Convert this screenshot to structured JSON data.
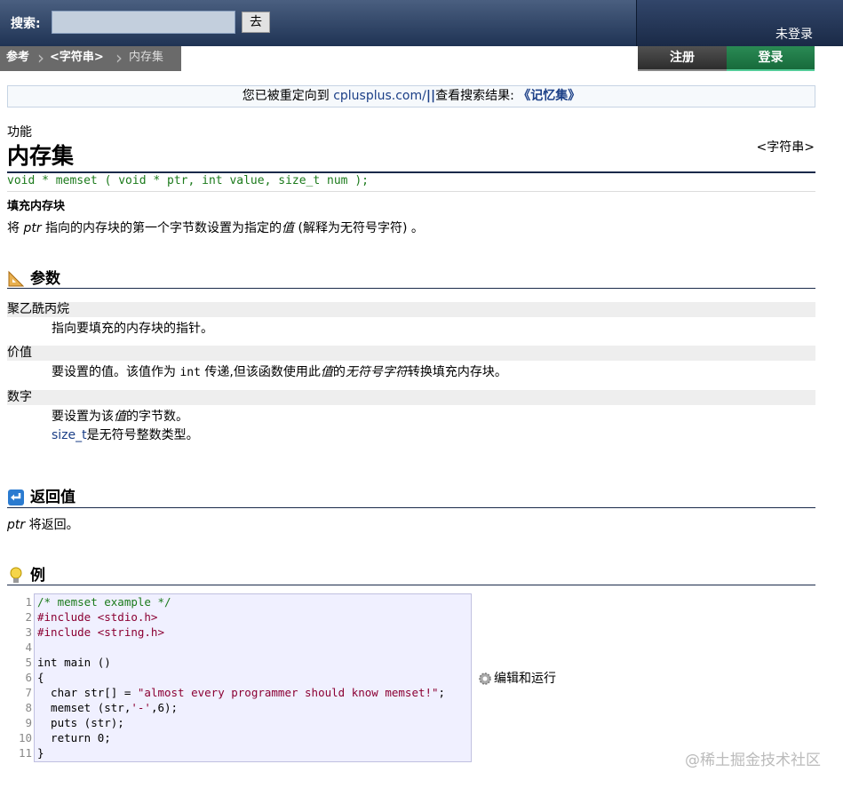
{
  "header": {
    "search_label": "搜索:",
    "search_value": "",
    "go_button": "去",
    "user_status": "未登录"
  },
  "breadcrumb": [
    "参考",
    "<字符串>",
    "内存集"
  ],
  "account": {
    "register": "注册",
    "login": "登录"
  },
  "redirect": {
    "prefix": "您已被重定向到",
    "site": "cplusplus.com/",
    "bars": "||",
    "middle": "查看搜索结果:",
    "result_link": "《记忆集》"
  },
  "reference": {
    "kind": "功能",
    "title": "内存集",
    "header_tag": "<字符串>",
    "prototype": "void * memset ( void * ptr, int value, size_t num );",
    "brief": "填充内存块",
    "desc": {
      "part1": "将",
      "ptr": "ptr",
      "part2": "指向的内存块的第一个字节数设置为指定的",
      "value": "值",
      "part3": "(解释为无符号字符) 。"
    }
  },
  "params": {
    "heading": "参数",
    "items": [
      {
        "name": "聚乙酰丙烷",
        "desc": "指向要填充的内存块的指针。"
      },
      {
        "name": "价值",
        "desc_parts": [
          "要设置的值。该值作为",
          "int",
          "传递,但该函数使用此",
          "值",
          "的",
          "无符号字符",
          "转换填充内存块。"
        ]
      },
      {
        "name": "数字",
        "desc_line1": [
          "要设置为该",
          "值",
          "的字节数。"
        ],
        "desc_line2": [
          "size_t",
          "是无符号整数类型。"
        ]
      }
    ]
  },
  "return": {
    "heading": "返回值",
    "ptr": "ptr",
    "text": "将返回。"
  },
  "example": {
    "heading": "例",
    "line_numbers": [
      "1",
      "2",
      "3",
      "4",
      "5",
      "6",
      "7",
      "8",
      "9",
      "10",
      "11"
    ],
    "lines": [
      "/* memset example */",
      "#include <stdio.h>",
      "#include <string.h>",
      "",
      "int main ()",
      "{",
      "  char str[] = \"almost every programmer should know memset!\";",
      "  memset (str,'-',6);",
      "  puts (str);",
      "  return 0;",
      "}"
    ],
    "run_label": "编辑和运行"
  },
  "watermark": "@稀土掘金技术社区",
  "colors": {
    "topbar": "#1f3354",
    "login": "#176a3b",
    "code_bg": "#f0f0ff",
    "link": "#1b3f87"
  }
}
